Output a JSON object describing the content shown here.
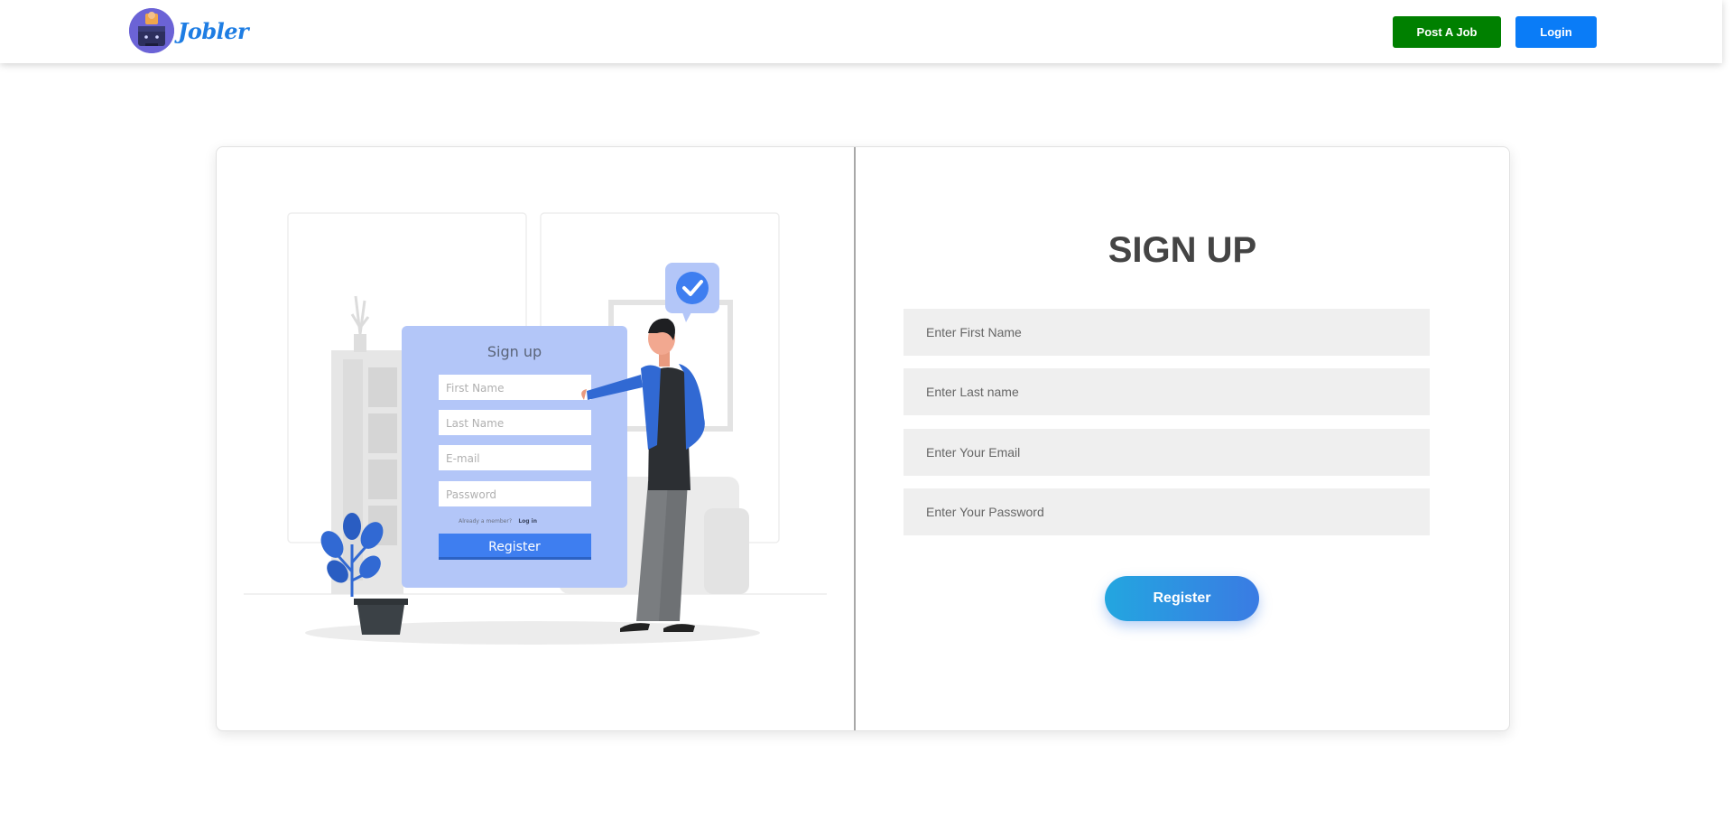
{
  "navbar": {
    "logo_text": "Jobler",
    "post_job_label": "Post A Job",
    "login_label": "Login"
  },
  "illustration": {
    "title": "Sign up",
    "fields": [
      "First Name",
      "Last Name",
      "E-mail",
      "Password"
    ],
    "already_member": "Already a member?",
    "login_link": "Log in",
    "register_label": "Register"
  },
  "form": {
    "title": "SIGN UP",
    "first_name_placeholder": "Enter First Name",
    "last_name_placeholder": "Enter Last name",
    "email_placeholder": "Enter Your Email",
    "password_placeholder": "Enter Your Password",
    "register_label": "Register"
  },
  "colors": {
    "post_job": "#008000",
    "login": "#0a7cf7",
    "accent_blue": "#3a7be3"
  }
}
